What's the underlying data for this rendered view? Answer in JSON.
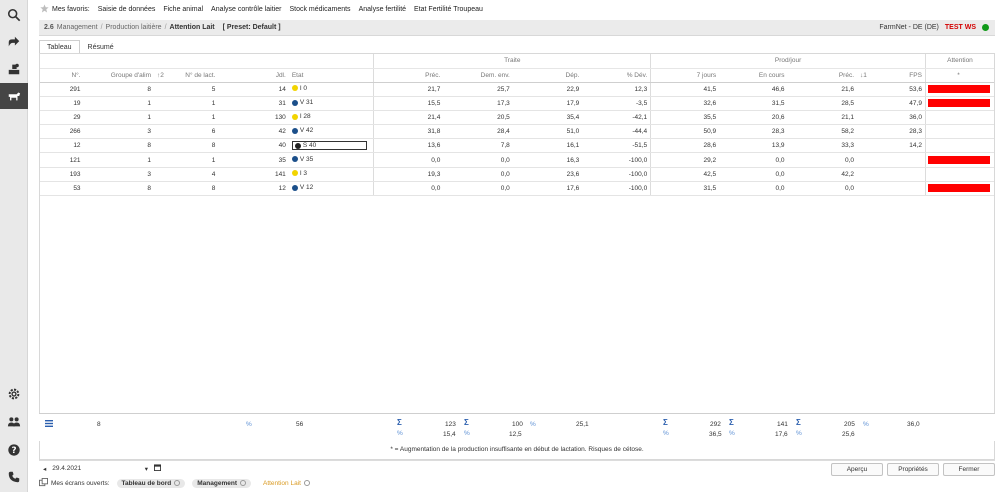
{
  "favorites": {
    "label": "Mes favoris:",
    "items": [
      "Saisie de données",
      "Fiche animal",
      "Analyse contrôle laitier",
      "Stock médicaments",
      "Analyse fertilité",
      "Etat Fertilité Troupeau"
    ]
  },
  "titlebar": {
    "number": "2.6",
    "crumbs": [
      "Management",
      "Production laitière",
      "Attention Lait"
    ],
    "preset": "[ Preset: Default ]",
    "env": "FarmNet - DE (DE)",
    "test": "TEST WS",
    "status_color": "#119a1a"
  },
  "tabs": [
    "Tableau",
    "Résumé"
  ],
  "groups": {
    "traite": "Traite",
    "prodjour": "Prod/jour",
    "attention": "Attention"
  },
  "columns": {
    "no": "N°.",
    "groupe": "Groupe d'alim",
    "sort1": "↑2",
    "nlact": "N° de lact.",
    "jdl": "Jdl.",
    "etat": "Etat",
    "prec": "Préc.",
    "demenv": "Dem. env.",
    "dep": "Dép.",
    "pdev": "% Dév.",
    "j7": "7 jours",
    "encours": "En cours",
    "prec2": "Préc.",
    "sort2": "↓1",
    "fps": "FPS",
    "att": "*"
  },
  "rows": [
    {
      "no": "291",
      "groupe": "8",
      "nlact": "5",
      "jdl": "14",
      "dot": "#f2d400",
      "etat": "I 0",
      "prec": "21,7",
      "demenv": "25,7",
      "dep": "22,9",
      "pdev": "12,3",
      "j7": "41,5",
      "encours": "46,6",
      "prec2": "21,6",
      "fps": "53,6",
      "attention": true,
      "selected": false
    },
    {
      "no": "19",
      "groupe": "1",
      "nlact": "1",
      "jdl": "31",
      "dot": "#1b4f8a",
      "etat": "V 31",
      "prec": "15,5",
      "demenv": "17,3",
      "dep": "17,9",
      "pdev": "-3,5",
      "j7": "32,6",
      "encours": "31,5",
      "prec2": "28,5",
      "fps": "47,9",
      "attention": true,
      "selected": false
    },
    {
      "no": "29",
      "groupe": "1",
      "nlact": "1",
      "jdl": "130",
      "dot": "#f2d400",
      "etat": "I 28",
      "prec": "21,4",
      "demenv": "20,5",
      "dep": "35,4",
      "pdev": "-42,1",
      "j7": "35,5",
      "encours": "20,6",
      "prec2": "21,1",
      "fps": "36,0",
      "attention": false,
      "selected": false
    },
    {
      "no": "266",
      "groupe": "3",
      "nlact": "6",
      "jdl": "42",
      "dot": "#1b4f8a",
      "etat": "V 42",
      "prec": "31,8",
      "demenv": "28,4",
      "dep": "51,0",
      "pdev": "-44,4",
      "j7": "50,9",
      "encours": "28,3",
      "prec2": "58,2",
      "fps": "28,3",
      "attention": false,
      "selected": false
    },
    {
      "no": "12",
      "groupe": "8",
      "nlact": "8",
      "jdl": "40",
      "dot": "#222222",
      "etat": "S 40",
      "prec": "13,6",
      "demenv": "7,8",
      "dep": "16,1",
      "pdev": "-51,5",
      "j7": "28,6",
      "encours": "13,9",
      "prec2": "33,3",
      "fps": "14,2",
      "attention": false,
      "selected": true
    },
    {
      "no": "121",
      "groupe": "1",
      "nlact": "1",
      "jdl": "35",
      "dot": "#1b4f8a",
      "etat": "V 35",
      "prec": "0,0",
      "demenv": "0,0",
      "dep": "16,3",
      "pdev": "-100,0",
      "j7": "29,2",
      "encours": "0,0",
      "prec2": "0,0",
      "fps": "",
      "attention": true,
      "selected": false
    },
    {
      "no": "193",
      "groupe": "3",
      "nlact": "4",
      "jdl": "141",
      "dot": "#f2d400",
      "etat": "I 3",
      "prec": "19,3",
      "demenv": "0,0",
      "dep": "23,6",
      "pdev": "-100,0",
      "j7": "42,5",
      "encours": "0,0",
      "prec2": "42,2",
      "fps": "",
      "attention": false,
      "selected": false
    },
    {
      "no": "53",
      "groupe": "8",
      "nlact": "8",
      "jdl": "12",
      "dot": "#1b4f8a",
      "etat": "V 12",
      "prec": "0,0",
      "demenv": "0,0",
      "dep": "17,6",
      "pdev": "-100,0",
      "j7": "31,5",
      "encours": "0,0",
      "prec2": "0,0",
      "fps": "",
      "attention": true,
      "selected": false
    }
  ],
  "footer": {
    "count": "8",
    "jdl_avg": "56",
    "prec_sum": "123",
    "prec_avg": "15,4",
    "demenv_sum": "100",
    "demenv_avg": "12,5",
    "dep_avg": "25,1",
    "j7_sum": "292",
    "j7_avg": "36,5",
    "encours_sum": "141",
    "encours_avg": "17,6",
    "prec2_sum": "205",
    "prec2_avg": "25,6",
    "fps_avg": "36,0",
    "sigma": "Σ",
    "pct": "%"
  },
  "note": "* = Augmentation de la production insuffisante en début de lactation. Risques de cétose.",
  "date": "29.4.2021",
  "buttons": {
    "apercu": "Aperçu",
    "proprietes": "Propriétés",
    "fermer": "Fermer"
  },
  "open_screens": {
    "label": "Mes écrans ouverts:",
    "items": [
      "Tableau de bord",
      "Management"
    ],
    "current": "Attention Lait"
  },
  "colors": {
    "attention_bar": "#ff0000",
    "test_label": "#d30000",
    "sidebar_active": "#454545"
  }
}
